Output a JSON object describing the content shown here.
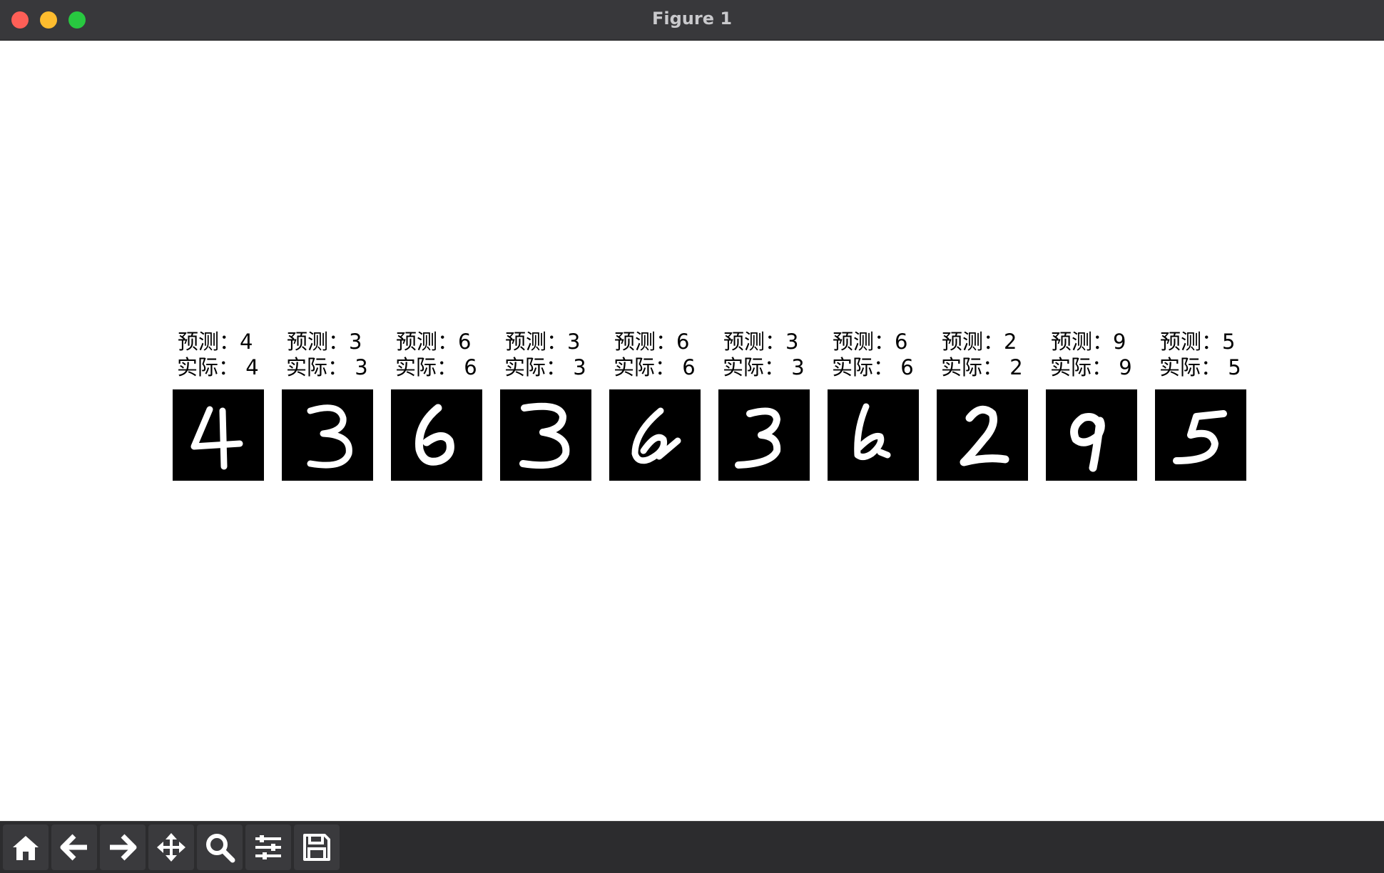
{
  "window": {
    "title": "Figure 1"
  },
  "panels": [
    {
      "pred": "预测：4",
      "actual": "实际： 4",
      "digit": "4"
    },
    {
      "pred": "预测：3",
      "actual": "实际： 3",
      "digit": "3"
    },
    {
      "pred": "预测：6",
      "actual": "实际： 6",
      "digit": "6"
    },
    {
      "pred": "预测：3",
      "actual": "实际： 3",
      "digit": "3"
    },
    {
      "pred": "预测：6",
      "actual": "实际： 6",
      "digit": "6"
    },
    {
      "pred": "预测：3",
      "actual": "实际： 3",
      "digit": "3"
    },
    {
      "pred": "预测：6",
      "actual": "实际： 6",
      "digit": "6"
    },
    {
      "pred": "预测：2",
      "actual": "实际： 2",
      "digit": "2"
    },
    {
      "pred": "预测：9",
      "actual": "实际： 9",
      "digit": "9"
    },
    {
      "pred": "预测：5",
      "actual": "实际： 5",
      "digit": "5"
    }
  ],
  "toolbar": {
    "buttons": [
      {
        "name": "home",
        "icon": "home-icon"
      },
      {
        "name": "back",
        "icon": "arrow-left-icon"
      },
      {
        "name": "forward",
        "icon": "arrow-right-icon"
      },
      {
        "name": "pan",
        "icon": "move-icon"
      },
      {
        "name": "zoom",
        "icon": "zoom-icon"
      },
      {
        "name": "configure-subplots",
        "icon": "sliders-icon"
      },
      {
        "name": "save",
        "icon": "save-icon"
      }
    ]
  },
  "colors": {
    "titlebar": "#38383b",
    "toolbar": "#2c2c2e",
    "digit_bg": "#000000",
    "digit_fg": "#ffffff"
  }
}
